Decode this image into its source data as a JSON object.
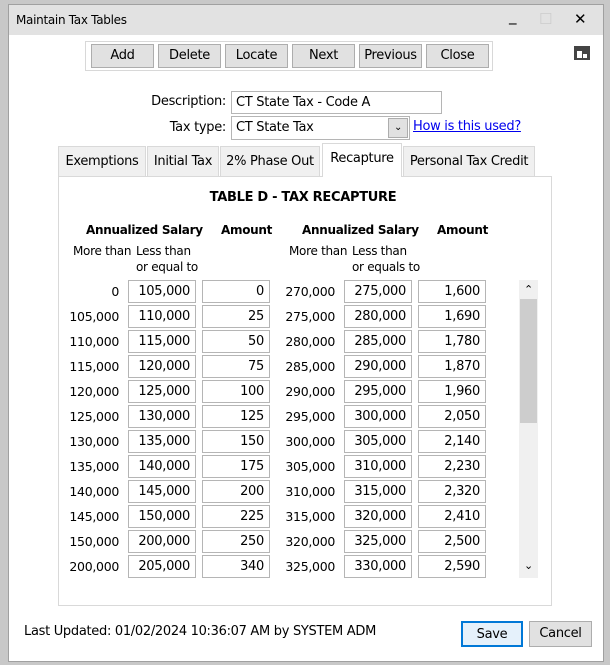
{
  "window": {
    "title": "Maintain Tax Tables",
    "minimize": "_",
    "maximize": "☐",
    "close": "✕"
  },
  "toolbar": {
    "add": "Add",
    "delete": "Delete",
    "locate": "Locate",
    "next": "Next",
    "previous": "Previous",
    "close": "Close"
  },
  "form": {
    "description_label": "Description:",
    "description_value": "CT State Tax - Code A",
    "tax_type_label": "Tax type:",
    "tax_type_value": "CT State Tax",
    "help_link": "How is this used?"
  },
  "tabs": [
    "Exemptions",
    "Initial Tax",
    "2% Phase Out",
    "Recapture",
    "Personal Tax Credit"
  ],
  "table": {
    "title": "TABLE D - TAX RECAPTURE",
    "left": {
      "group": "Annualized Salary",
      "amount": "Amount",
      "more_than": "More than",
      "less_than": "Less than",
      "less_than2": "or equal to"
    },
    "right": {
      "group": "Annualized Salary",
      "amount": "Amount",
      "more_than": "More than",
      "less_than": "Less than",
      "less_than2": "or equals to"
    },
    "rows": [
      [
        "0",
        "105,000",
        "0",
        "270,000",
        "275,000",
        "1,600"
      ],
      [
        "105,000",
        "110,000",
        "25",
        "275,000",
        "280,000",
        "1,690"
      ],
      [
        "110,000",
        "115,000",
        "50",
        "280,000",
        "285,000",
        "1,780"
      ],
      [
        "115,000",
        "120,000",
        "75",
        "285,000",
        "290,000",
        "1,870"
      ],
      [
        "120,000",
        "125,000",
        "100",
        "290,000",
        "295,000",
        "1,960"
      ],
      [
        "125,000",
        "130,000",
        "125",
        "295,000",
        "300,000",
        "2,050"
      ],
      [
        "130,000",
        "135,000",
        "150",
        "300,000",
        "305,000",
        "2,140"
      ],
      [
        "135,000",
        "140,000",
        "175",
        "305,000",
        "310,000",
        "2,230"
      ],
      [
        "140,000",
        "145,000",
        "200",
        "310,000",
        "315,000",
        "2,320"
      ],
      [
        "145,000",
        "150,000",
        "225",
        "315,000",
        "320,000",
        "2,410"
      ],
      [
        "150,000",
        "200,000",
        "250",
        "320,000",
        "325,000",
        "2,500"
      ],
      [
        "200,000",
        "205,000",
        "340",
        "325,000",
        "330,000",
        "2,590"
      ]
    ]
  },
  "footer": {
    "last_updated": "Last Updated: 01/02/2024 10:36:07 AM by SYSTEM ADM",
    "save": "Save",
    "cancel": "Cancel"
  }
}
